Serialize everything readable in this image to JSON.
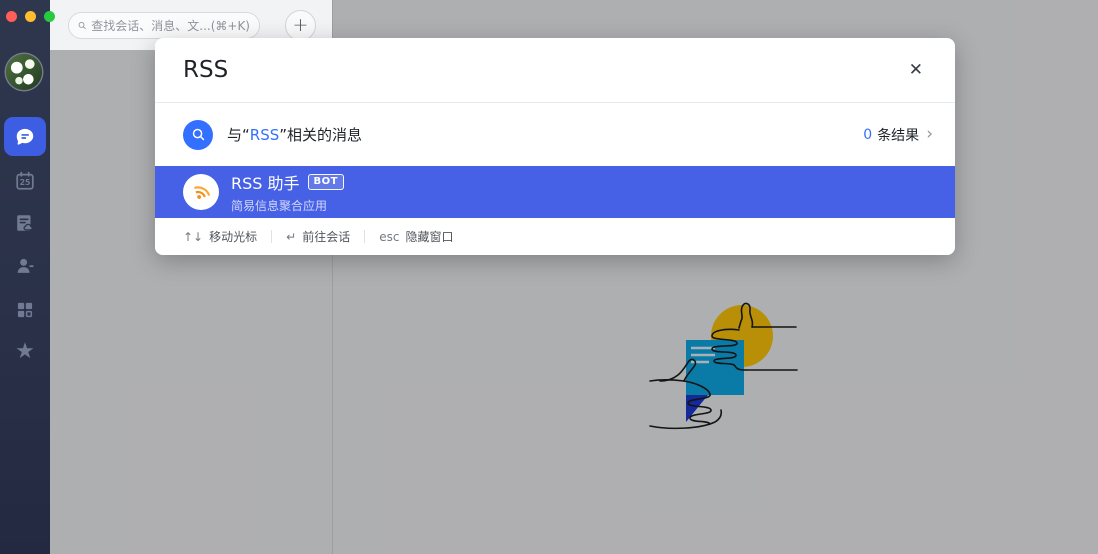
{
  "window": {
    "traffic_lights": [
      "close",
      "minimize",
      "zoom"
    ]
  },
  "sidebar": {
    "calendar_day": "25",
    "items": [
      {
        "id": "messages",
        "active": true
      },
      {
        "id": "calendar",
        "active": false
      },
      {
        "id": "docs",
        "active": false
      },
      {
        "id": "contacts",
        "active": false
      },
      {
        "id": "workplace",
        "active": false
      },
      {
        "id": "favorites",
        "active": false
      }
    ],
    "favorites_star": "★"
  },
  "top_bar": {
    "search_placeholder": "查找会话、消息、文...",
    "search_shortcut": "(⌘+K)",
    "new_chat_label": "+"
  },
  "search_modal": {
    "query": "RSS",
    "close_label": "✕",
    "message_result": {
      "text_prefix": "与“",
      "keyword": "RSS",
      "text_suffix": "”相关的消息",
      "result_count": "0",
      "result_count_label": "条结果",
      "chevron": "›"
    },
    "bot_result": {
      "title": "RSS 助手",
      "badge": "BOT",
      "subtitle": "简易信息聚合应用"
    },
    "footer_hints": [
      {
        "key": "↑↓",
        "label": "移动光标"
      },
      {
        "key": "↵",
        "label": "前往会话"
      },
      {
        "key": "esc",
        "label": "隐藏窗口"
      }
    ]
  },
  "colors": {
    "accent_blue": "#3370ff",
    "selected_row_blue": "#4660e6",
    "active_nav_blue": "#3d5de2",
    "sidebar_bg": "#2a3148",
    "rss_orange": "#f98e1b",
    "illustration_gold": "#ffc60a",
    "illustration_blue": "#0fa9e8",
    "traffic_red": "#ff5f57",
    "traffic_yellow": "#febc2e",
    "traffic_green": "#28c840"
  }
}
